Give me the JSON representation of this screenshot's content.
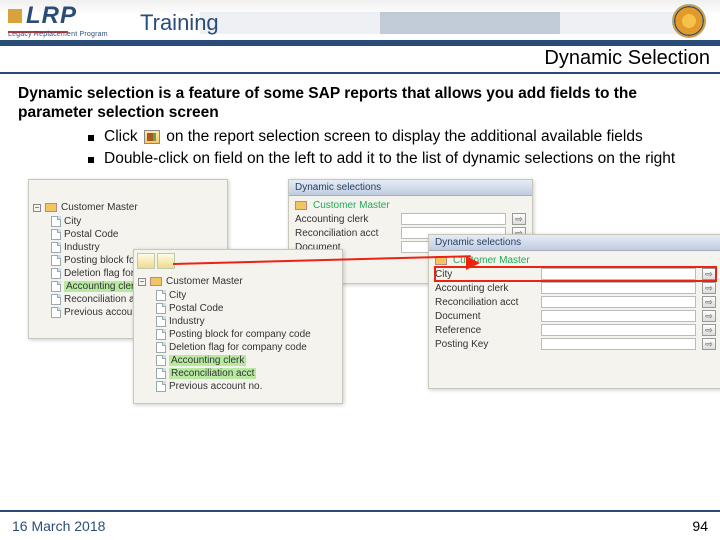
{
  "header": {
    "logo_text": "LRP",
    "logo_subtext": "Legacy Replacement Program",
    "section": "Training"
  },
  "subtitle": "Dynamic Selection",
  "intro": "Dynamic selection is a feature of some SAP reports that allows you add fields to the parameter selection screen",
  "bullets": [
    {
      "pre": "Click ",
      "post": " on the report selection screen to display the additional available fields"
    },
    {
      "text": "Double-click on field on the left to add it to the list of dynamic selections on the right"
    }
  ],
  "sap": {
    "tree_root": "Customer Master",
    "tree1_items": [
      "City",
      "Postal Code",
      "Industry",
      "Posting block for",
      "Deletion flag for",
      "Accounting clerk",
      "Reconciliation ac",
      "Previous account"
    ],
    "tree1_highlight_index": 5,
    "tree2_items": [
      "City",
      "Postal Code",
      "Industry",
      "Posting block for company code",
      "Deletion flag for company code",
      "Accounting clerk",
      "Reconciliation acct",
      "Previous account no."
    ],
    "tree2_highlight": [
      5,
      6
    ],
    "dyn_title": "Dynamic selections",
    "dyn1_fields": [
      "Accounting clerk",
      "Reconciliation acct",
      "Document"
    ],
    "dyn2_fields": [
      "City",
      "Accounting clerk",
      "Reconciliation acct",
      "Document",
      "Reference",
      "Posting Key"
    ],
    "dyn2_highlight_index": 0
  },
  "footer": {
    "date": "16 March 2018",
    "page": "94"
  }
}
